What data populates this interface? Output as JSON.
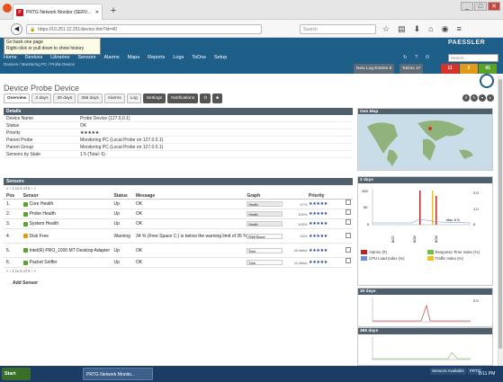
{
  "browser": {
    "tab_title": "PRTG Network Monitor (SERV...",
    "url": "https://10.251.12.251/device.htm?id=40",
    "search_placeholder": "Search",
    "tooltip_line1": "Go back one page",
    "tooltip_line2": "Right-click or pull down to show history"
  },
  "prtg": {
    "brand": "PAESSLER",
    "header_search_placeholder": "Search...",
    "menu": [
      "Home",
      "Devices",
      "Libraries",
      "Sensors",
      "Alarms",
      "Maps",
      "Reports",
      "Logs",
      "ToDos",
      "Setup"
    ],
    "breadcrumb": "Devices / Monitoring PC / Probe Device",
    "new_log_label": "New Log Entries",
    "new_log_count": "8",
    "todos_label": "ToDos",
    "todos_count": "17",
    "chips": [
      {
        "value": "11",
        "color": "#d9322b"
      },
      {
        "value": "2",
        "color": "#e39a17"
      },
      {
        "value": "41",
        "color": "#5ba22b"
      }
    ]
  },
  "page": {
    "title": "Device Probe Device",
    "tabs": [
      "Overview",
      "2 days",
      "30 days",
      "365 days",
      "Alarms",
      "Log"
    ],
    "settings_label": "Settings",
    "notifications_label": "Notifications"
  },
  "details": {
    "header": "Details",
    "rows": [
      {
        "key": "Device Name",
        "value": "Probe Device (127.0.0.1)"
      },
      {
        "key": "Status",
        "value": "OK"
      },
      {
        "key": "Priority",
        "value": "★★★★★"
      },
      {
        "key": "Parent Probe",
        "value": "Monitoring PC (Local Probe on 127.0.0.1)"
      },
      {
        "key": "Parent Group",
        "value": "Monitoring PC (Local Probe on 127.0.0.1)"
      },
      {
        "key": "Sensors by State",
        "value": "1  5  (Total: 6)"
      }
    ]
  },
  "sensors": {
    "header": "Sensors",
    "pager": "1 to 6 of 6",
    "pager_bottom": "1 to 6 of 6",
    "columns": [
      "Pos",
      "Sensor",
      "Status",
      "Message",
      "Graph",
      "Priority"
    ],
    "rows": [
      {
        "pos": "1.",
        "name": "Core Health",
        "status": "Up",
        "message": "OK",
        "graph_label": "Health",
        "pct": "97%",
        "fill": 0.97,
        "color": "#5ba22b",
        "tall": false
      },
      {
        "pos": "2.",
        "name": "Probe Health",
        "status": "Up",
        "message": "OK",
        "graph_label": "Health",
        "pct": "100%",
        "fill": 1.0,
        "color": "#5ba22b",
        "tall": false
      },
      {
        "pos": "3.",
        "name": "System Health",
        "status": "Up",
        "message": "OK",
        "graph_label": "Health",
        "pct": "100%",
        "fill": 1.0,
        "color": "#5ba22b",
        "tall": false
      },
      {
        "pos": "4.",
        "name": "Disk Free",
        "status": "Warning",
        "message": "34 % (Free Space C:) is below the warning limit of 35 %",
        "graph_label": "Free Space",
        "pct": "34%",
        "fill": 0.34,
        "color": "#e39a17",
        "tall": true
      },
      {
        "pos": "5.",
        "name": "Intel(R) PRO_1000 MT Desktop Adapter",
        "status": "Up",
        "message": "OK",
        "graph_label": "Total",
        "pct": "30 kbit/s",
        "fill": 0.1,
        "color": "#5ba22b",
        "tall": true
      },
      {
        "pos": "6.",
        "name": "Packet Sniffer",
        "status": "Up",
        "message": "OK",
        "graph_label": "Total",
        "pct": "11 kbit/s",
        "fill": 0.05,
        "color": "#5ba22b",
        "tall": false
      }
    ],
    "add_label": "Add Sensor"
  },
  "right": {
    "geomap_header": "Geo Map",
    "chart_2d_header": "2 days",
    "chart_30d_header": "30 days",
    "chart_365d_header": "365 days",
    "chart_yaxis": [
      "100",
      "50",
      "0"
    ],
    "chart_right_axis": [
      "2.0",
      "1.0",
      "0"
    ],
    "chart_max_label": "Max: 8 %",
    "x_dates_2d": [
      "8/27",
      "8/28",
      "8/28"
    ],
    "legend": [
      {
        "label": "Alarms (#)",
        "color": "#c0261f"
      },
      {
        "label": "Response Time Index (%)",
        "color": "#6fbf4a"
      },
      {
        "label": "CPU Load Index (%)",
        "color": "#6d8fe0"
      },
      {
        "label": "Traffic Index (%)",
        "color": "#f2c21a"
      }
    ]
  },
  "taskbar": {
    "start": "Start",
    "item": "PRTG Network Monito...",
    "tray1": "Sensors Available",
    "tray2": "PRTG",
    "clock": "8:11 PM"
  }
}
